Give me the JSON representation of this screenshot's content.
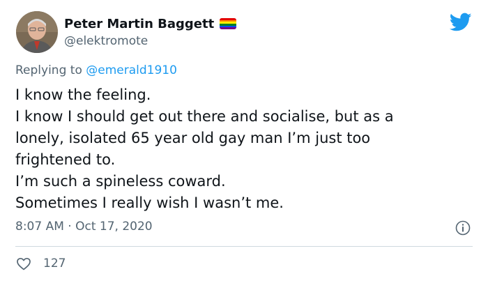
{
  "author": {
    "display_name": "Peter Martin Baggett",
    "handle": "@elektromote",
    "flag_colors": [
      "#e40303",
      "#ff8c00",
      "#ffed00",
      "#008026",
      "#004dff",
      "#750787"
    ]
  },
  "reply": {
    "prefix": "Replying to",
    "target": "@emerald1910"
  },
  "tweet": {
    "lines": [
      "I know the feeling.",
      "I know I should get out there and socialise, but as a",
      "lonely, isolated 65 year old gay man I’m just too",
      "frightened to.",
      "I’m such a spineless coward.",
      "Sometimes I really wish I wasn’t me."
    ],
    "timestamp": "8:07 AM · Oct 17, 2020",
    "like_count": "127"
  },
  "colors": {
    "brand": "#1d9bf0",
    "text": "#0f1419",
    "secondary": "#536471",
    "divider": "#cfd9de"
  },
  "icons": [
    "twitter-bird-icon",
    "info-icon",
    "heart-icon",
    "pride-flag-icon"
  ]
}
